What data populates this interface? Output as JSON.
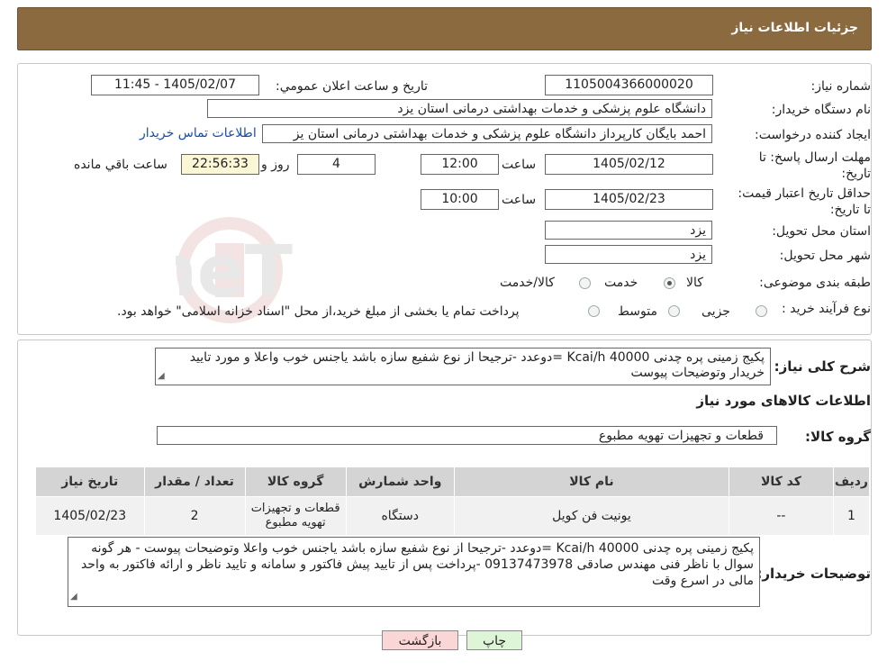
{
  "header": {
    "title": "جزئیات اطلاعات نیاز"
  },
  "form": {
    "need_number_label": "شماره نیاز:",
    "need_number": "1105004366000020",
    "announce_label": "تاريخ و ساعت اعلان عمومي:",
    "announce_value": "1405/02/07 - 11:45",
    "buyer_org_label": "نام دستگاه خريدار:",
    "buyer_org": "دانشگاه علوم پزشکی و خدمات بهداشتی  درمانی استان یزد",
    "creator_label": "ايجاد کننده درخواست:",
    "creator": "احمد بایگان کارپرداز دانشگاه علوم پزشکی و خدمات بهداشتی  درمانی استان یز",
    "contact_link": "اطلاعات تماس خريدار",
    "deadline_label": "مهلت ارسال پاسخ: تا تاریخ:",
    "deadline_date": "1405/02/12",
    "time_label": "ساعت",
    "deadline_time": "12:00",
    "days_value": "4",
    "days_label": "روز و",
    "remaining_time": "22:56:33",
    "remaining_label": "ساعت باقي مانده",
    "validity_label": "حداقل تاريخ اعتبار قيمت: تا تاریخ:",
    "validity_date": "1405/02/23",
    "validity_time": "10:00",
    "province_label": "استان محل تحويل:",
    "province": "یزد",
    "city_label": "شهر محل تحويل:",
    "city": "یزد",
    "category_label": "طبقه بندی موضوعی:",
    "category_options": [
      "کالا",
      "خدمت",
      "کالا/خدمت"
    ],
    "category_selected": "کالا",
    "process_label": "نوع فرآیند خرید :",
    "process_options": [
      "جزیی",
      "متوسط"
    ],
    "process_note": "پرداخت تمام یا بخشی از مبلغ خرید،از محل \"اسناد خزانه اسلامی\" خواهد بود."
  },
  "description": {
    "label": "شرح کلی نیاز:",
    "text": "پکیج زمینی پره چدنی Kcai/h 40000 =دوعدد -ترجیحا از نوع شفیع سازه باشد یاجنس خوب واعلا و مورد تایید خریدار وتوضیحات پیوست"
  },
  "goods": {
    "section_title": "اطلاعات کالاهای مورد نياز",
    "group_label": "گروه کالا:",
    "group_value": "قطعات و تجهیزات تهویه مطبوع"
  },
  "table": {
    "headers": [
      "رديف",
      "کد کالا",
      "نام کالا",
      "واحد شمارش",
      "گروه کالا",
      "تعداد / مقدار",
      "تاريخ نياز"
    ],
    "rows": [
      [
        "1",
        "--",
        "یونیت فن کویل",
        "دستگاه",
        "قطعات و تجهیزات تهویه مطبوع",
        "2",
        "1405/02/23"
      ]
    ]
  },
  "buyer_notes": {
    "label": "توضيحات خريدار:",
    "text": "پکیج زمینی پره چدنی Kcai/h 40000 =دوعدد -ترجیحا از نوع شفیع سازه باشد یاجنس خوب واعلا وتوضیحات پیوست  - هر گونه سوال با ناظر فنی مهندس صادقی 09137473978 -پرداخت پس از تایید پیش فاکتور و سامانه و تایید ناظر و ارائه فاکتور به واحد مالی در اسرع وقت"
  },
  "buttons": {
    "print": "چاپ",
    "back": "بازگشت"
  },
  "watermark": {
    "text": "AriaTender.neT"
  },
  "colors": {
    "header_bg": "#8b6a3f",
    "remaining_bg": "#fbf6d6",
    "back_bg": "#fbd6d6",
    "print_bg": "#dff5d8",
    "link": "#1a4da8"
  }
}
